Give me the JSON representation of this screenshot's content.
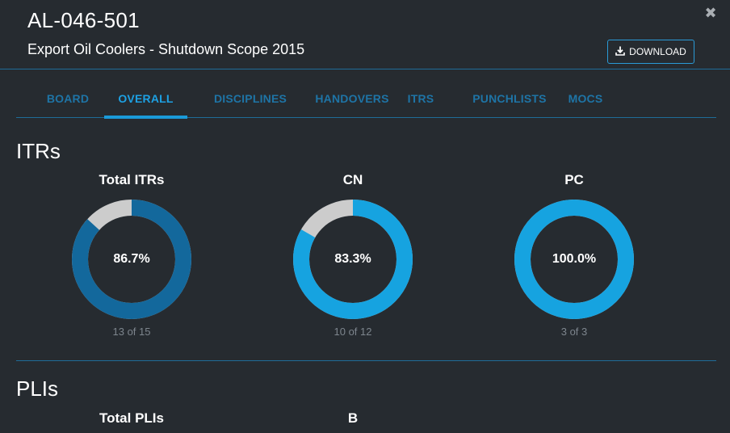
{
  "header": {
    "tag": "AL-046-501",
    "description": "Export Oil Coolers - Shutdown Scope 2015",
    "download_label": "DOWNLOAD",
    "close_glyph": "✖"
  },
  "tabs": [
    {
      "label": "BOARD",
      "active": false
    },
    {
      "label": "OVERALL",
      "active": true
    },
    {
      "label": "DISCIPLINES",
      "active": false
    },
    {
      "label": "HANDOVERS",
      "active": false
    },
    {
      "label": "ITRS",
      "active": false
    },
    {
      "label": "PUNCHLISTS",
      "active": false
    },
    {
      "label": "MOCS",
      "active": false
    }
  ],
  "itrs": {
    "title": "ITRs",
    "charts": [
      {
        "label": "Total ITRs",
        "percent_text": "86.7%",
        "fraction": 0.867,
        "count_text": "13 of 15",
        "color": "#13689c"
      },
      {
        "label": "CN",
        "percent_text": "83.3%",
        "fraction": 0.833,
        "count_text": "10 of 12",
        "color": "#16a3e0"
      },
      {
        "label": "PC",
        "percent_text": "100.0%",
        "fraction": 1.0,
        "count_text": "3 of 3",
        "color": "#16a3e0"
      }
    ],
    "remainder_color": "#cccccc"
  },
  "plis": {
    "title": "PLIs",
    "charts": [
      {
        "label": "Total PLIs"
      },
      {
        "label": "B"
      }
    ]
  },
  "colors": {
    "background": "#262b30",
    "accent": "#1a9ad9",
    "tab_inactive": "#1e74a6",
    "divider": "#1f6c98"
  },
  "icons": {
    "close": "close-icon",
    "download": "download-icon"
  }
}
